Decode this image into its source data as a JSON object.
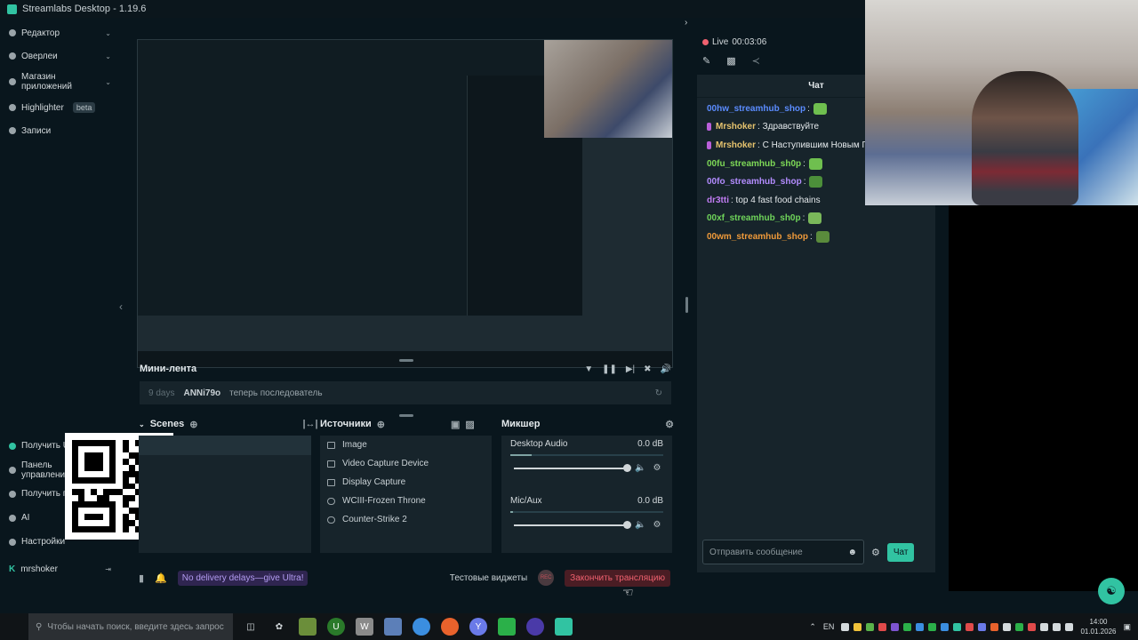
{
  "window": {
    "title": "Streamlabs Desktop - 1.19.6"
  },
  "sidebar": {
    "items": [
      {
        "label": "Редактор",
        "chevron": true
      },
      {
        "label": "Оверлеи",
        "chevron": true
      },
      {
        "label": "Магазин приложений",
        "chevron": true
      },
      {
        "label": "Highlighter",
        "badge": "beta"
      },
      {
        "label": "Записи"
      }
    ],
    "bottom": [
      {
        "label": "Получить U"
      },
      {
        "label": "Панель управлени"
      },
      {
        "label": "Получить п"
      },
      {
        "label": "AI"
      },
      {
        "label": "Настройки"
      }
    ],
    "user": "mrshoker"
  },
  "minifeed": {
    "title": "Мини-лента",
    "event": {
      "days": "9 days",
      "name": "ANNi79o",
      "text": "теперь последователь"
    }
  },
  "scenes": {
    "title": "Scenes"
  },
  "sources": {
    "title": "Источники",
    "items": [
      "Image",
      "Video Capture Device",
      "Display Capture",
      "WCIII-Frozen Throne",
      "Counter-Strike 2"
    ]
  },
  "mixer": {
    "title": "Микшер",
    "channels": [
      {
        "name": "Desktop Audio",
        "level": "0.0 dB"
      },
      {
        "name": "Mic/Aux",
        "level": "0.0 dB"
      }
    ]
  },
  "footer": {
    "promo": "No delivery delays—give Ultra!",
    "test_widgets": "Тестовые виджеты",
    "rec": "REC",
    "end_stream": "Закончить трансляцию"
  },
  "live": {
    "label": "Live",
    "time": "00:03:06"
  },
  "chat": {
    "title": "Чат",
    "messages": [
      {
        "user": "00hw_streamhub_shop",
        "text": ":",
        "color": "#5b8cff",
        "emote": "#6fbf4f"
      },
      {
        "user": "Mrshoker",
        "text": ": Здравствуйте",
        "color": "#e6c36e",
        "mic": true
      },
      {
        "user": "Mrshoker",
        "text": ": С Наступившим Новым Годом",
        "color": "#e6c36e",
        "mic": true
      },
      {
        "user": "00fu_streamhub_sh0p",
        "text": ":",
        "color": "#7ed957",
        "emote": "#6fbf4f"
      },
      {
        "user": "00fo_streamhub_shop",
        "text": ":",
        "color": "#b38cff",
        "emote": "#4c8f3a"
      },
      {
        "user": "dr3tti",
        "text": ": top 4 fast food chains",
        "color": "#c07cf2"
      },
      {
        "user": "00xf_streamhub_sh0p",
        "text": ":",
        "color": "#6fd45a",
        "emote": "#7ab85a"
      },
      {
        "user": "00wm_streamhub_shop",
        "text": ":",
        "color": "#ef9a3a",
        "emote": "#5a8b3c"
      }
    ],
    "input_placeholder": "Отправить сообщение",
    "send_label": "Чат"
  },
  "taskbar": {
    "search_placeholder": "Чтобы начать поиск, введите здесь запрос",
    "lang": "EN",
    "time": "14:00",
    "date": "01.01.2026"
  },
  "colors": {
    "accent": "#31c3a2",
    "live": "#f0616f",
    "promo": "#b39cf2"
  }
}
